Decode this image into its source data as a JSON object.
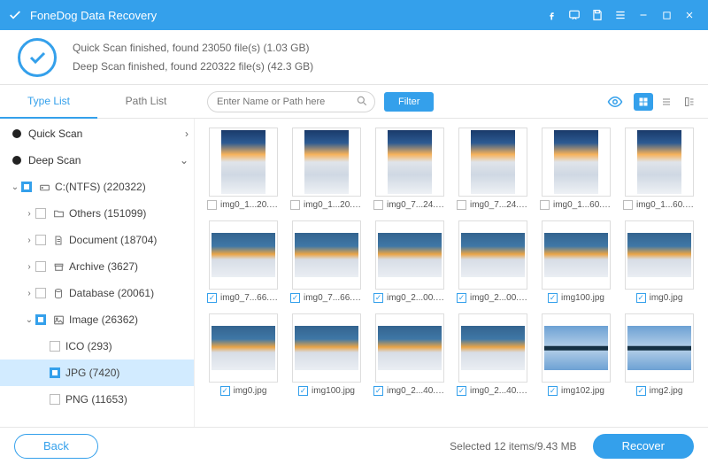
{
  "app": {
    "title": "FoneDog Data Recovery"
  },
  "scan": {
    "quick": "Quick Scan finished, found 23050 file(s) (1.03 GB)",
    "deep": "Deep Scan finished, found 220322 file(s) (42.3 GB)"
  },
  "tabs": {
    "type": "Type List",
    "path": "Path List"
  },
  "search": {
    "placeholder": "Enter Name or Path here"
  },
  "filter_label": "Filter",
  "tree": {
    "quick": "Quick Scan",
    "deep": "Deep Scan",
    "drive": "C:(NTFS) (220322)",
    "others": "Others (151099)",
    "document": "Document (18704)",
    "archive": "Archive (3627)",
    "database": "Database (20061)",
    "image": "Image (26362)",
    "ico": "ICO (293)",
    "jpg": "JPG (7420)",
    "png": "PNG (11653)"
  },
  "grid": [
    {
      "name": "img0_1...20.jpg",
      "checked": false,
      "kind": "sky"
    },
    {
      "name": "img0_1...20.jpg",
      "checked": false,
      "kind": "sky"
    },
    {
      "name": "img0_7...24.jpg",
      "checked": false,
      "kind": "sky"
    },
    {
      "name": "img0_7...24.jpg",
      "checked": false,
      "kind": "sky"
    },
    {
      "name": "img0_1...60.jpg",
      "checked": false,
      "kind": "sky"
    },
    {
      "name": "img0_1...60.jpg",
      "checked": false,
      "kind": "sky"
    },
    {
      "name": "img0_7...66.jpg",
      "checked": true,
      "kind": "skyw"
    },
    {
      "name": "img0_7...66.jpg",
      "checked": true,
      "kind": "skyw"
    },
    {
      "name": "img0_2...00.jpg",
      "checked": true,
      "kind": "skyw"
    },
    {
      "name": "img0_2...00.jpg",
      "checked": true,
      "kind": "skyw"
    },
    {
      "name": "img100.jpg",
      "checked": true,
      "kind": "skyw"
    },
    {
      "name": "img0.jpg",
      "checked": true,
      "kind": "skyw"
    },
    {
      "name": "img0.jpg",
      "checked": true,
      "kind": "skyw"
    },
    {
      "name": "img100.jpg",
      "checked": true,
      "kind": "skyw"
    },
    {
      "name": "img0_2...40.jpg",
      "checked": true,
      "kind": "skyw"
    },
    {
      "name": "img0_2...40.jpg",
      "checked": true,
      "kind": "skyw"
    },
    {
      "name": "img102.jpg",
      "checked": true,
      "kind": "island"
    },
    {
      "name": "img2.jpg",
      "checked": true,
      "kind": "island"
    }
  ],
  "footer": {
    "back": "Back",
    "status": "Selected 12 items/9.43 MB",
    "recover": "Recover"
  }
}
